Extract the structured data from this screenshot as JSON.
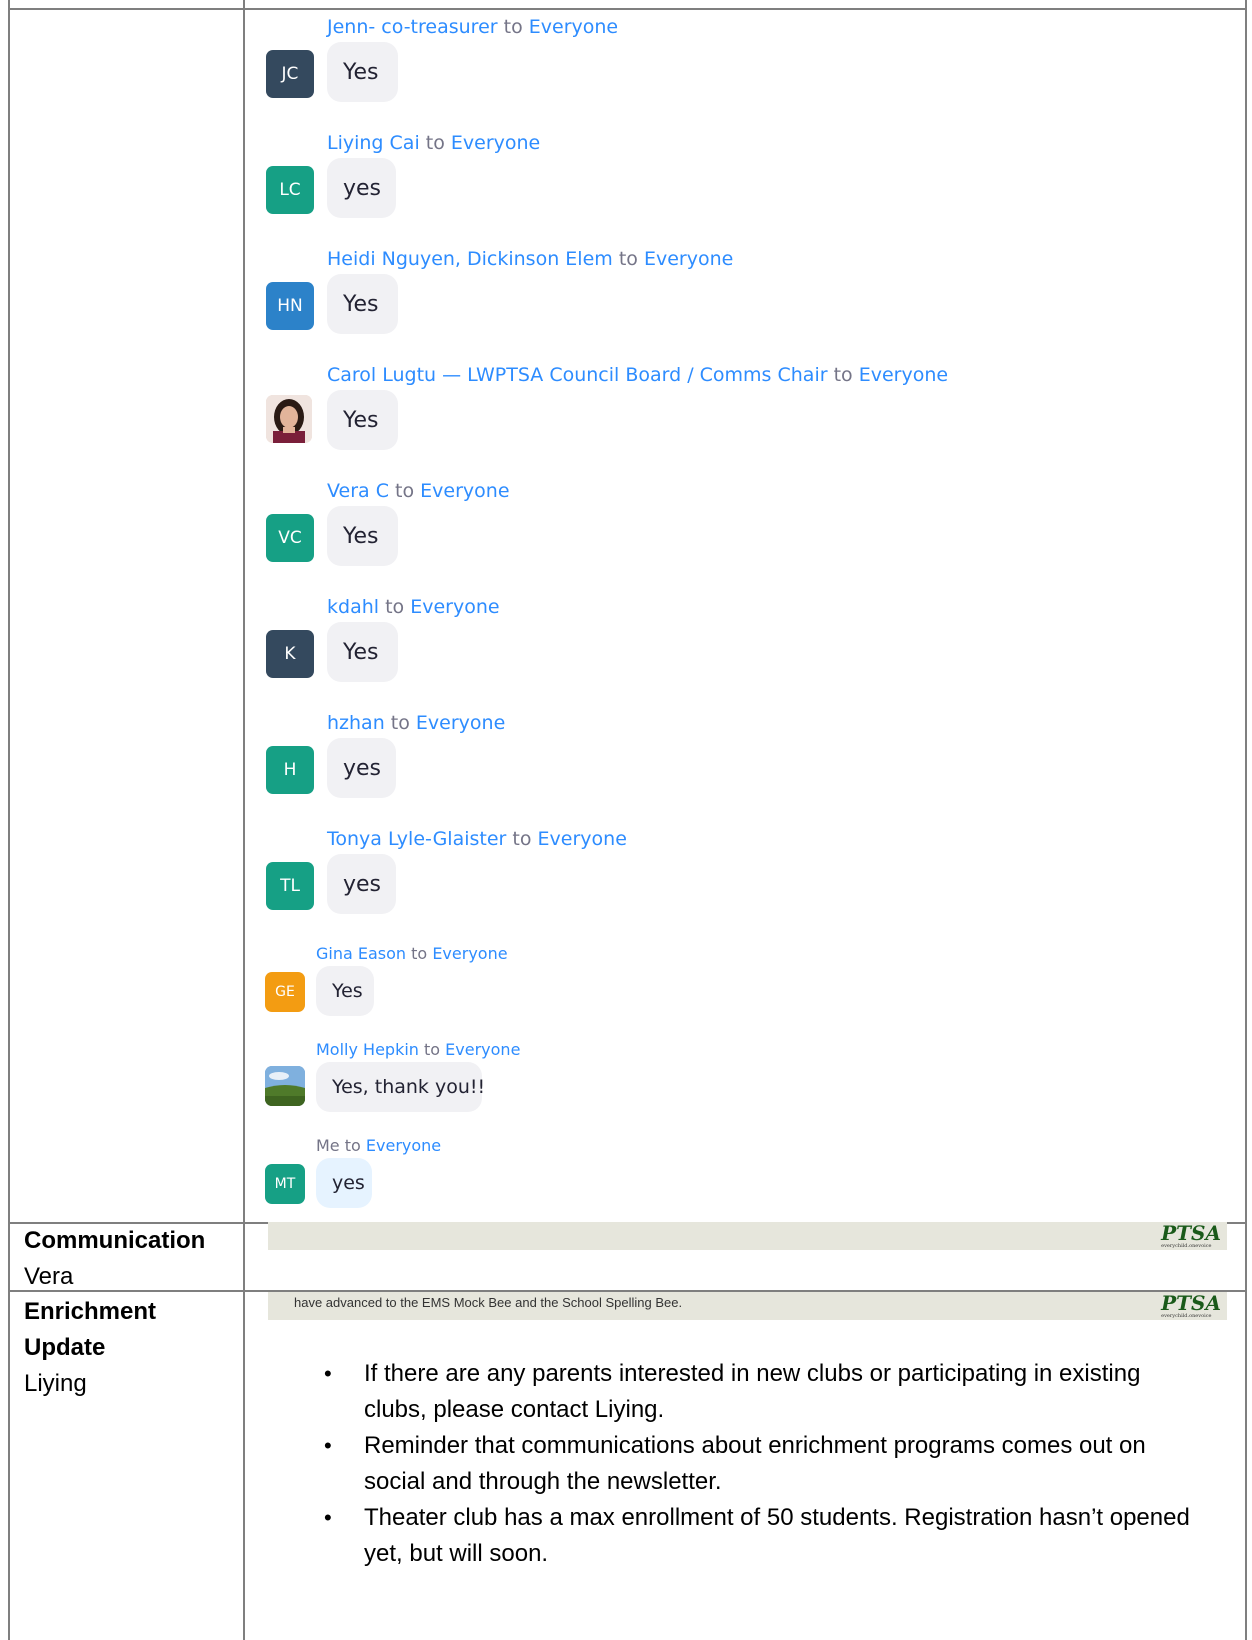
{
  "chat": {
    "to_word": "to",
    "messages": [
      {
        "sender": "Jenn- co-treasurer",
        "recipient": "Everyone",
        "initials": "JC",
        "avatar_color": "#34495e",
        "text": "Yes",
        "top": 0
      },
      {
        "sender": "Liying Cai",
        "recipient": "Everyone",
        "initials": "LC",
        "avatar_color": "#16a085",
        "text": "yes"
      },
      {
        "sender": "Heidi Nguyen, Dickinson Elem",
        "recipient": "Everyone",
        "initials": "HN",
        "avatar_color": "#2c82c9",
        "text": "Yes"
      },
      {
        "sender": "Carol Lugtu — LWPTSA Council Board / Comms Chair",
        "recipient": "Everyone",
        "initials": "",
        "avatar_color": "photo",
        "text": "Yes"
      },
      {
        "sender": "Vera C",
        "recipient": "Everyone",
        "initials": "VC",
        "avatar_color": "#16a085",
        "text": "Yes"
      },
      {
        "sender": "kdahl",
        "recipient": "Everyone",
        "initials": "K",
        "avatar_color": "#34495e",
        "text": "Yes"
      },
      {
        "sender": "hzhan",
        "recipient": "Everyone",
        "initials": "H",
        "avatar_color": "#16a085",
        "text": "yes"
      },
      {
        "sender": "Tonya Lyle-Glaister",
        "recipient": "Everyone",
        "initials": "TL",
        "avatar_color": "#16a085",
        "text": "yes"
      },
      {
        "sender": "Gina Eason",
        "recipient": "Everyone",
        "initials": "GE",
        "avatar_color": "#f39c12",
        "text": "Yes"
      },
      {
        "sender": "Molly Hepkin",
        "recipient": "Everyone",
        "initials": "",
        "avatar_color": "landscape",
        "text": "Yes, thank you!!"
      },
      {
        "sender": "Me",
        "recipient": "Everyone",
        "initials": "MT",
        "avatar_color": "#16a085",
        "text": "yes"
      }
    ]
  },
  "rows": {
    "communication": {
      "title": "Communication",
      "owner": "Vera"
    },
    "enrichment": {
      "title_line1": "Enrichment",
      "title_line2": "Update",
      "owner": "Liying",
      "banner_text": "have advanced to the EMS Mock Bee and the School Spelling Bee.",
      "notes": [
        "If there are any parents interested in new clubs or participating in existing clubs, please contact Liying.",
        "Reminder that communications about enrichment programs comes out on social and through the newsletter.",
        "Theater club has a max enrollment of 50 students. Registration hasn’t opened yet, but will soon."
      ]
    }
  },
  "logo": {
    "text": "PTSA",
    "tagline": "everychild.onevoice"
  }
}
